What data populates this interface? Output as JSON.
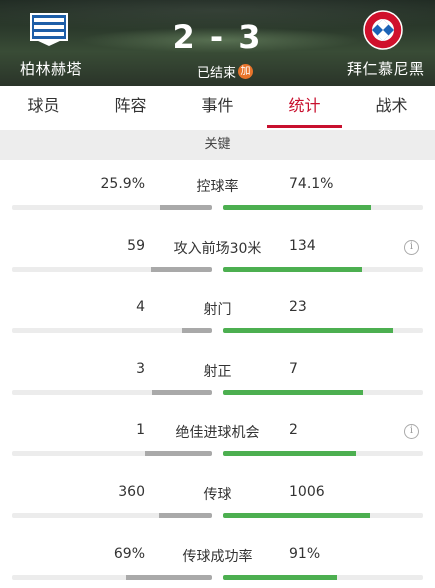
{
  "match": {
    "home_team": "柏林赫塔",
    "away_team": "拜仁慕尼黑",
    "score": "2 - 3",
    "status": "已结束",
    "status_badge": "加"
  },
  "tabs": [
    {
      "label": "球员"
    },
    {
      "label": "阵容"
    },
    {
      "label": "事件"
    },
    {
      "label": "统计",
      "active": true
    },
    {
      "label": "战术"
    }
  ],
  "section": {
    "title": "关键"
  },
  "stats": [
    {
      "label": "控球率",
      "home": "25.9%",
      "away": "74.1%",
      "home_share": 0.259,
      "away_share": 0.741,
      "info": false
    },
    {
      "label": "攻入前场30米",
      "home": "59",
      "away": "134",
      "home_share": 0.306,
      "away_share": 0.694,
      "info": true
    },
    {
      "label": "射门",
      "home": "4",
      "away": "23",
      "home_share": 0.148,
      "away_share": 0.852,
      "info": false
    },
    {
      "label": "射正",
      "home": "3",
      "away": "7",
      "home_share": 0.3,
      "away_share": 0.7,
      "info": false
    },
    {
      "label": "绝佳进球机会",
      "home": "1",
      "away": "2",
      "home_share": 0.333,
      "away_share": 0.667,
      "info": true
    },
    {
      "label": "传球",
      "home": "360",
      "away": "1006",
      "home_share": 0.264,
      "away_share": 0.736,
      "info": false
    },
    {
      "label": "传球成功率",
      "home": "69%",
      "away": "91%",
      "home_share": 0.431,
      "away_share": 0.569,
      "info": false
    }
  ],
  "icons": {
    "info": "info-icon",
    "home_crest": "hertha-crest-icon",
    "away_crest": "bayern-crest-icon"
  },
  "colors": {
    "accent": "#c8102e",
    "away_bar": "#4caf50",
    "home_bar": "#a9a9a9",
    "badge": "#e8742b"
  }
}
